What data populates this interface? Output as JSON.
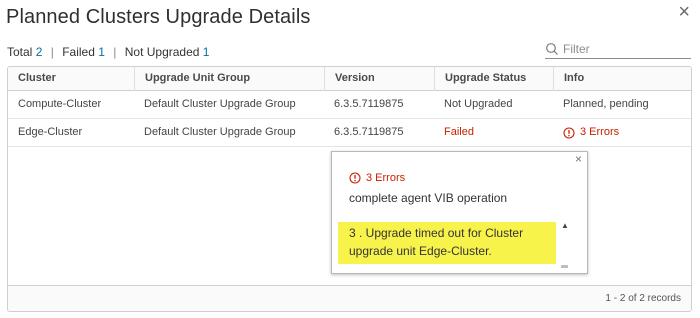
{
  "dialog": {
    "title": "Planned Clusters Upgrade Details",
    "close_glyph": "×"
  },
  "summary": {
    "total_label": "Total",
    "total_count": "2",
    "failed_label": "Failed",
    "failed_count": "1",
    "not_upgraded_label": "Not Upgraded",
    "not_upgraded_count": "1",
    "separator": "|"
  },
  "filter": {
    "placeholder": "Filter",
    "value": ""
  },
  "table": {
    "columns": [
      "Cluster",
      "Upgrade Unit Group",
      "Version",
      "Upgrade Status",
      "Info"
    ],
    "rows": [
      {
        "cluster": "Compute-Cluster",
        "group": "Default Cluster Upgrade Group",
        "version": "6.3.5.7119875",
        "status": "Not Upgraded",
        "info": "Planned, pending"
      },
      {
        "cluster": "Edge-Cluster",
        "group": "Default Cluster Upgrade Group",
        "version": "6.3.5.7119875",
        "status": "Failed",
        "info": "3 Errors"
      }
    ],
    "footer": "1 - 2 of 2 records"
  },
  "popover": {
    "title": "3 Errors",
    "line1": "complete agent VIB operation",
    "line2": "3 .  Upgrade timed out for Cluster upgrade unit Edge-Cluster.",
    "close_glyph": "×"
  },
  "colors": {
    "error": "#c92100",
    "link": "#0072a3",
    "highlight": "#f7f34a"
  }
}
